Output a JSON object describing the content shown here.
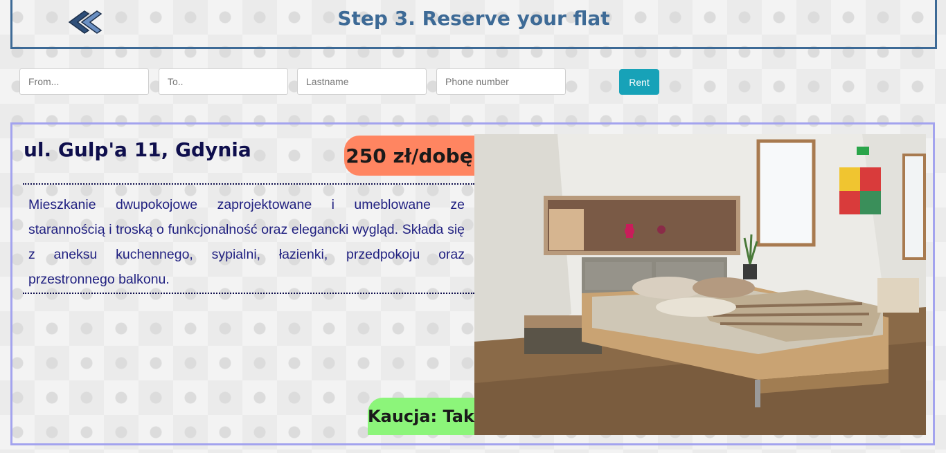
{
  "header": {
    "title": "Step 3. Reserve your flat",
    "back_icon": "double-chevron-left-icon"
  },
  "form": {
    "from_placeholder": "From...",
    "to_placeholder": "To..",
    "lastname_placeholder": "Lastname",
    "phone_placeholder": "Phone number",
    "rent_label": "Rent"
  },
  "listing": {
    "address": "ul. Gulp'a 11, Gdynia",
    "price": "250 zł/dobę",
    "description": "Mieszkanie dwupokojowe zaprojektowane i umeblowane ze starannością i troską o funkcjonalność oraz elegancki wygląd. Składa się z aneksu kuchennego, sypialni, łazienki, przedpokoju oraz przestronnego balkonu.",
    "deposit": "Kaucja: Tak",
    "image": "bedroom-photo"
  },
  "colors": {
    "header_border": "#3d6a96",
    "card_border": "#a3a3ee",
    "price_badge": "#ff8561",
    "deposit_badge": "#8cf57a",
    "rent_button": "#17a2b8"
  }
}
